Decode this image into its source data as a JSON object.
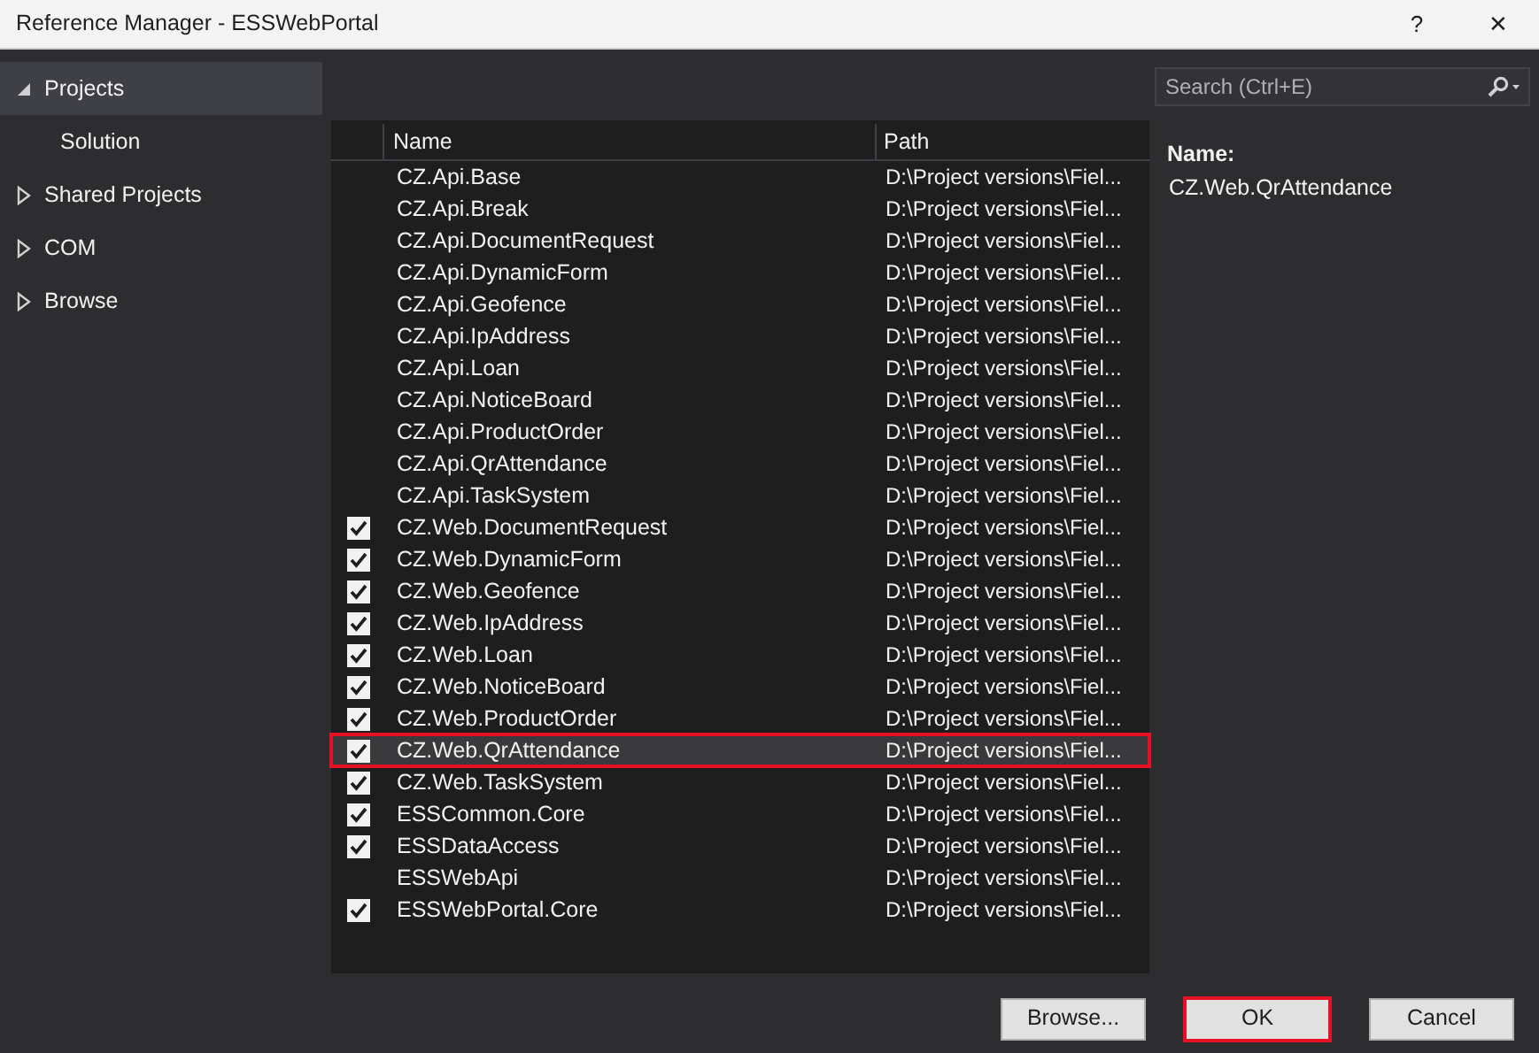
{
  "window": {
    "title": "Reference Manager - ESSWebPortal",
    "help": "?",
    "close": "✕"
  },
  "sidebar": {
    "items": [
      {
        "label": "Projects",
        "expanded": true,
        "selected": true,
        "children": [
          {
            "label": "Solution",
            "selected": false
          }
        ]
      },
      {
        "label": "Shared Projects",
        "expanded": false,
        "selected": false
      },
      {
        "label": "COM",
        "expanded": false,
        "selected": false
      },
      {
        "label": "Browse",
        "expanded": false,
        "selected": false
      }
    ]
  },
  "search": {
    "placeholder": "Search (Ctrl+E)"
  },
  "table": {
    "columns": [
      "Name",
      "Path"
    ],
    "rows": [
      {
        "name": "CZ.Api.Base",
        "path": "D:\\Project versions\\Fiel...",
        "checked": false,
        "selected": false
      },
      {
        "name": "CZ.Api.Break",
        "path": "D:\\Project versions\\Fiel...",
        "checked": false,
        "selected": false
      },
      {
        "name": "CZ.Api.DocumentRequest",
        "path": "D:\\Project versions\\Fiel...",
        "checked": false,
        "selected": false
      },
      {
        "name": "CZ.Api.DynamicForm",
        "path": "D:\\Project versions\\Fiel...",
        "checked": false,
        "selected": false
      },
      {
        "name": "CZ.Api.Geofence",
        "path": "D:\\Project versions\\Fiel...",
        "checked": false,
        "selected": false
      },
      {
        "name": "CZ.Api.IpAddress",
        "path": "D:\\Project versions\\Fiel...",
        "checked": false,
        "selected": false
      },
      {
        "name": "CZ.Api.Loan",
        "path": "D:\\Project versions\\Fiel...",
        "checked": false,
        "selected": false
      },
      {
        "name": "CZ.Api.NoticeBoard",
        "path": "D:\\Project versions\\Fiel...",
        "checked": false,
        "selected": false
      },
      {
        "name": "CZ.Api.ProductOrder",
        "path": "D:\\Project versions\\Fiel...",
        "checked": false,
        "selected": false
      },
      {
        "name": "CZ.Api.QrAttendance",
        "path": "D:\\Project versions\\Fiel...",
        "checked": false,
        "selected": false
      },
      {
        "name": "CZ.Api.TaskSystem",
        "path": "D:\\Project versions\\Fiel...",
        "checked": false,
        "selected": false
      },
      {
        "name": "CZ.Web.DocumentRequest",
        "path": "D:\\Project versions\\Fiel...",
        "checked": true,
        "selected": false
      },
      {
        "name": "CZ.Web.DynamicForm",
        "path": "D:\\Project versions\\Fiel...",
        "checked": true,
        "selected": false
      },
      {
        "name": "CZ.Web.Geofence",
        "path": "D:\\Project versions\\Fiel...",
        "checked": true,
        "selected": false
      },
      {
        "name": "CZ.Web.IpAddress",
        "path": "D:\\Project versions\\Fiel...",
        "checked": true,
        "selected": false
      },
      {
        "name": "CZ.Web.Loan",
        "path": "D:\\Project versions\\Fiel...",
        "checked": true,
        "selected": false
      },
      {
        "name": "CZ.Web.NoticeBoard",
        "path": "D:\\Project versions\\Fiel...",
        "checked": true,
        "selected": false
      },
      {
        "name": "CZ.Web.ProductOrder",
        "path": "D:\\Project versions\\Fiel...",
        "checked": true,
        "selected": false
      },
      {
        "name": "CZ.Web.QrAttendance",
        "path": "D:\\Project versions\\Fiel...",
        "checked": true,
        "selected": true
      },
      {
        "name": "CZ.Web.TaskSystem",
        "path": "D:\\Project versions\\Fiel...",
        "checked": true,
        "selected": false
      },
      {
        "name": "ESSCommon.Core",
        "path": "D:\\Project versions\\Fiel...",
        "checked": true,
        "selected": false
      },
      {
        "name": "ESSDataAccess",
        "path": "D:\\Project versions\\Fiel...",
        "checked": true,
        "selected": false
      },
      {
        "name": "ESSWebApi",
        "path": "D:\\Project versions\\Fiel...",
        "checked": false,
        "selected": false
      },
      {
        "name": "ESSWebPortal.Core",
        "path": "D:\\Project versions\\Fiel...",
        "checked": true,
        "selected": false
      }
    ]
  },
  "details": {
    "label": "Name:",
    "value": "CZ.Web.QrAttendance"
  },
  "buttons": [
    {
      "label": "Browse...",
      "highlighted": false
    },
    {
      "label": "OK",
      "highlighted": true
    },
    {
      "label": "Cancel",
      "highlighted": false
    }
  ]
}
